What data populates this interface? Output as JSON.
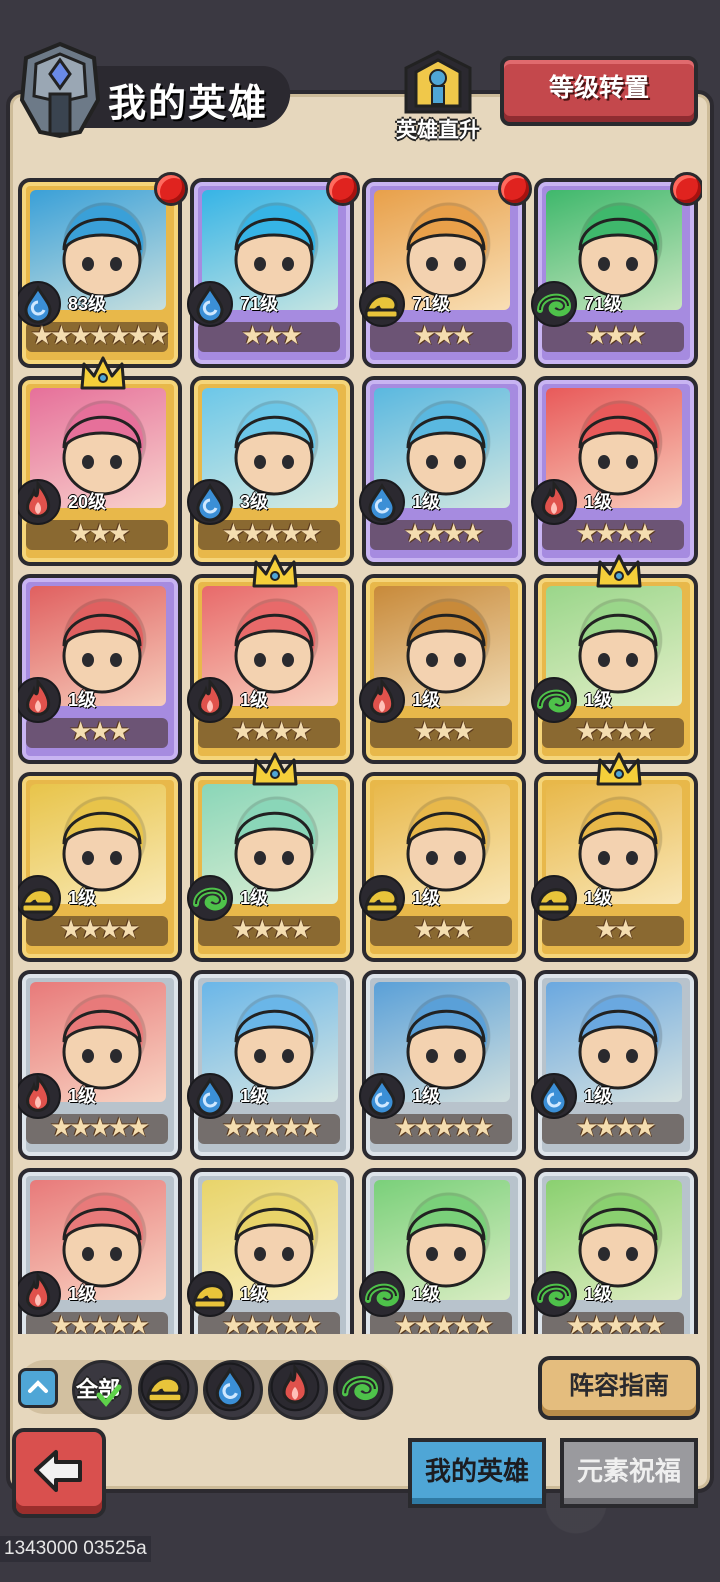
{
  "header": {
    "title": "我的英雄",
    "direct_upgrade_label": "英雄直升",
    "level_transfer_button": "等级转置"
  },
  "colors": {
    "gold_card": "#e8b84a",
    "purple_card": "#a68be0",
    "silver_card": "#b8c3cc",
    "water": "#3b8fd6",
    "fire": "#e0524c",
    "earth": "#e8c43a",
    "wind": "#4ec24a"
  },
  "heroes": [
    {
      "level": "83级",
      "stars": "★★★★★★★",
      "element": "water",
      "frame": "gold",
      "badge": true,
      "crown": false,
      "art": "#3aa0d8"
    },
    {
      "level": "71级",
      "stars": "★★★",
      "element": "water",
      "frame": "purple",
      "badge": true,
      "crown": false,
      "art": "#36b4e6"
    },
    {
      "level": "71级",
      "stars": "★★★",
      "element": "earth",
      "frame": "purple",
      "badge": true,
      "crown": false,
      "art": "#e8a04a"
    },
    {
      "level": "71级",
      "stars": "★★★",
      "element": "wind",
      "frame": "purple",
      "badge": true,
      "crown": false,
      "art": "#3fb86c"
    },
    {
      "level": "20级",
      "stars": "★★★",
      "element": "fire",
      "frame": "gold",
      "badge": false,
      "crown": true,
      "art": "#e6709a"
    },
    {
      "level": "3级",
      "stars": "★★★★★",
      "element": "water",
      "frame": "gold",
      "badge": false,
      "crown": false,
      "art": "#6cc7e8"
    },
    {
      "level": "1级",
      "stars": "★★★★",
      "element": "water",
      "frame": "purple",
      "badge": false,
      "crown": false,
      "art": "#5ab8e0"
    },
    {
      "level": "1级",
      "stars": "★★★★",
      "element": "fire",
      "frame": "purple",
      "badge": false,
      "crown": false,
      "art": "#e85a5a"
    },
    {
      "level": "1级",
      "stars": "★★★",
      "element": "fire",
      "frame": "purple",
      "badge": false,
      "crown": false,
      "art": "#e06060"
    },
    {
      "level": "1级",
      "stars": "★★★★",
      "element": "fire",
      "frame": "gold",
      "badge": false,
      "crown": true,
      "art": "#e86a6a"
    },
    {
      "level": "1级",
      "stars": "★★★",
      "element": "fire",
      "frame": "gold",
      "badge": false,
      "crown": false,
      "art": "#c88a3a"
    },
    {
      "level": "1级",
      "stars": "★★★★",
      "element": "wind",
      "frame": "gold",
      "badge": false,
      "crown": true,
      "art": "#9ad68a"
    },
    {
      "level": "1级",
      "stars": "★★★★",
      "element": "earth",
      "frame": "gold",
      "badge": false,
      "crown": false,
      "art": "#e8c44a"
    },
    {
      "level": "1级",
      "stars": "★★★★",
      "element": "wind",
      "frame": "gold",
      "badge": false,
      "crown": true,
      "art": "#8ad6b8"
    },
    {
      "level": "1级",
      "stars": "★★★",
      "element": "earth",
      "frame": "gold",
      "badge": false,
      "crown": false,
      "art": "#e8b84a"
    },
    {
      "level": "1级",
      "stars": "★★",
      "element": "earth",
      "frame": "gold",
      "badge": false,
      "crown": true,
      "art": "#e8b84a"
    },
    {
      "level": "1级",
      "stars": "★★★★★",
      "element": "fire",
      "frame": "silver",
      "badge": false,
      "crown": false,
      "art": "#e87a7a"
    },
    {
      "level": "1级",
      "stars": "★★★★★",
      "element": "water",
      "frame": "silver",
      "badge": false,
      "crown": false,
      "art": "#6ab6e8"
    },
    {
      "level": "1级",
      "stars": "★★★★★",
      "element": "water",
      "frame": "silver",
      "badge": false,
      "crown": false,
      "art": "#5aa0d8"
    },
    {
      "level": "1级",
      "stars": "★★★★",
      "element": "water",
      "frame": "silver",
      "badge": false,
      "crown": false,
      "art": "#6aa8e0"
    },
    {
      "level": "1级",
      "stars": "★★★★★",
      "element": "fire",
      "frame": "silver",
      "badge": false,
      "crown": false,
      "art": "#e87a7a"
    },
    {
      "level": "1级",
      "stars": "★★★★★",
      "element": "earth",
      "frame": "silver",
      "badge": false,
      "crown": false,
      "art": "#e8d46a"
    },
    {
      "level": "1级",
      "stars": "★★★★★",
      "element": "wind",
      "frame": "silver",
      "badge": false,
      "crown": false,
      "art": "#7ad07a"
    },
    {
      "level": "1级",
      "stars": "★★★★★",
      "element": "wind",
      "frame": "silver",
      "badge": false,
      "crown": false,
      "art": "#8ad070"
    }
  ],
  "filter": {
    "all_label": "全部",
    "elements": [
      "earth",
      "water",
      "fire",
      "wind"
    ]
  },
  "guide_button": "阵容指南",
  "tabs": {
    "my_heroes": "我的英雄",
    "element_blessing": "元素祝福"
  },
  "footer_id": "1343000 03525a"
}
